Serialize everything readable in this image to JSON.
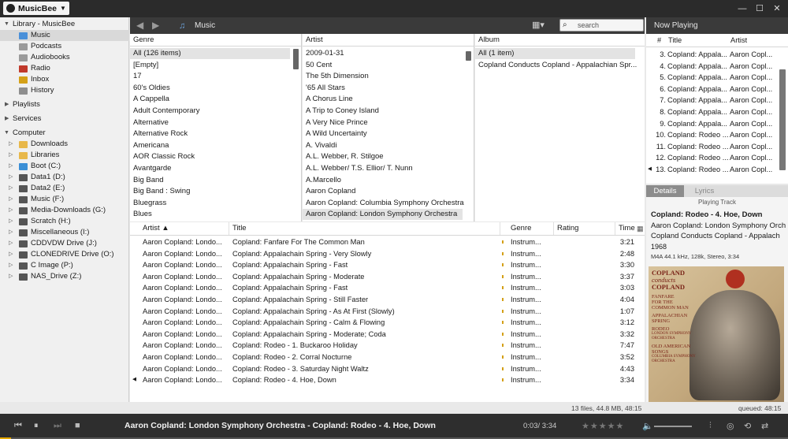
{
  "app": {
    "title": "MusicBee"
  },
  "sidebar": {
    "library_header": "Library - MusicBee",
    "library_items": [
      "Music",
      "Podcasts",
      "Audiobooks",
      "Radio",
      "Inbox",
      "History"
    ],
    "playlists": "Playlists",
    "services": "Services",
    "computer_header": "Computer",
    "drives": [
      "Downloads",
      "Libraries",
      "Boot (C:)",
      "Data1 (D:)",
      "Data2 (E:)",
      "Music (F:)",
      "Media-Downloads (G:)",
      "Scratch (H:)",
      "Miscellaneous (I:)",
      "CDDVDW Drive (J:)",
      "CLONEDRIVE Drive (O:)",
      "C Image (P:)",
      "NAS_Drive (Z:)"
    ]
  },
  "toolbar": {
    "title": "Music",
    "search_placeholder": "search"
  },
  "browser": {
    "genre": {
      "header": "Genre",
      "items": [
        "All  (126 items)",
        "[Empty]",
        "17",
        "60's Oldies",
        "A Cappella",
        "Adult Contemporary",
        "Alternative",
        "Alternative Rock",
        "Americana",
        "AOR Classic Rock",
        "Avantgarde",
        "Big Band",
        "Big Band : Swing",
        "Bluegrass",
        "Blues"
      ]
    },
    "artist": {
      "header": "Artist",
      "items": [
        "2009-01-31",
        "50 Cent",
        "The 5th Dimension",
        "'65 All Stars",
        "A Chorus Line",
        "A Trip to Coney Island",
        "A Very Nice Prince",
        "A Wild Uncertainty",
        "A. Vivaldi",
        "A.L. Webber, R. Stilgoe",
        "A.L. Webber/ T.S. Ellior/ T. Nunn",
        "A.Marcello",
        "Aaron Copland",
        "Aaron Copland: Columbia Symphony Orchestra",
        "Aaron Copland: London Symphony Orchestra"
      ]
    },
    "album": {
      "header": "Album",
      "items": [
        "All  (1 item)",
        "Copland Conducts Copland - Appalachian Spr..."
      ]
    }
  },
  "tracklist": {
    "columns": {
      "artist": "Artist",
      "title": "Title",
      "genre": "Genre",
      "rating": "Rating",
      "time": "Time"
    },
    "rows": [
      {
        "artist": "Aaron Copland: Londo...",
        "title": "Copland: Fanfare For The Common Man",
        "genre": "Instrum...",
        "time": "3:21"
      },
      {
        "artist": "Aaron Copland: Londo...",
        "title": "Copland: Appalachain Spring - Very Slowly",
        "genre": "Instrum...",
        "time": "2:48"
      },
      {
        "artist": "Aaron Copland: Londo...",
        "title": "Copland: Appalachain Spring - Fast",
        "genre": "Instrum...",
        "time": "3:30"
      },
      {
        "artist": "Aaron Copland: Londo...",
        "title": "Copland: Appalachain Spring - Moderate",
        "genre": "Instrum...",
        "time": "3:37"
      },
      {
        "artist": "Aaron Copland: Londo...",
        "title": "Copland: Appalachain Spring - Fast",
        "genre": "Instrum...",
        "time": "3:03"
      },
      {
        "artist": "Aaron Copland: Londo...",
        "title": "Copland: Appalachain Spring - Still Faster",
        "genre": "Instrum...",
        "time": "4:04"
      },
      {
        "artist": "Aaron Copland: Londo...",
        "title": "Copland: Appalachain Spring - As At First (Slowly)",
        "genre": "Instrum...",
        "time": "1:07"
      },
      {
        "artist": "Aaron Copland: Londo...",
        "title": "Copland: Appalachain Spring - Calm & Flowing",
        "genre": "Instrum...",
        "time": "3:12"
      },
      {
        "artist": "Aaron Copland: Londo...",
        "title": "Copland: Appalachain Spring - Moderate; Coda",
        "genre": "Instrum...",
        "time": "3:32"
      },
      {
        "artist": "Aaron Copland: Londo...",
        "title": "Copland: Rodeo - 1. Buckaroo Holiday",
        "genre": "Instrum...",
        "time": "7:47"
      },
      {
        "artist": "Aaron Copland: Londo...",
        "title": "Copland: Rodeo - 2. Corral Nocturne",
        "genre": "Instrum...",
        "time": "3:52"
      },
      {
        "artist": "Aaron Copland: Londo...",
        "title": "Copland: Rodeo - 3. Saturday Night Waltz",
        "genre": "Instrum...",
        "time": "4:43"
      },
      {
        "artist": "Aaron Copland: Londo...",
        "title": "Copland: Rodeo - 4. Hoe, Down",
        "genre": "Instrum...",
        "time": "3:34"
      }
    ],
    "playing_index": 12
  },
  "now_playing": {
    "header": "Now Playing",
    "columns": {
      "num": "#",
      "title": "Title",
      "artist": "Artist"
    },
    "rows": [
      {
        "num": "3.",
        "title": "Copland: Appala...",
        "artist": "Aaron Copl..."
      },
      {
        "num": "4.",
        "title": "Copland: Appala...",
        "artist": "Aaron Copl..."
      },
      {
        "num": "5.",
        "title": "Copland: Appala...",
        "artist": "Aaron Copl..."
      },
      {
        "num": "6.",
        "title": "Copland: Appala...",
        "artist": "Aaron Copl..."
      },
      {
        "num": "7.",
        "title": "Copland: Appala...",
        "artist": "Aaron Copl..."
      },
      {
        "num": "8.",
        "title": "Copland: Appala...",
        "artist": "Aaron Copl..."
      },
      {
        "num": "9.",
        "title": "Copland: Appala...",
        "artist": "Aaron Copl..."
      },
      {
        "num": "10.",
        "title": "Copland: Rodeo ...",
        "artist": "Aaron Copl..."
      },
      {
        "num": "11.",
        "title": "Copland: Rodeo ...",
        "artist": "Aaron Copl..."
      },
      {
        "num": "12.",
        "title": "Copland: Rodeo ...",
        "artist": "Aaron Copl..."
      },
      {
        "num": "13.",
        "title": "Copland: Rodeo ...",
        "artist": "Aaron Copl..."
      }
    ],
    "tabs": [
      "Details",
      "Lyrics"
    ]
  },
  "details": {
    "playing_track_label": "Playing Track",
    "title": "Copland: Rodeo - 4. Hoe, Down",
    "artist": "Aaron Copland: London Symphony Orch",
    "album": "Copland Conducts Copland - Appalach",
    "year": "1968",
    "format": "M4A 44.1 kHz, 128k, Stereo, 3:34",
    "art_text": {
      "line1": "COPLAND",
      "line2": "conducts",
      "line3": "COPLAND",
      "line4": "FANFARE",
      "line5": "FOR THE",
      "line6": "COMMON MAN",
      "line7": "APPALACHIAN",
      "line8": "SPRING",
      "line9": "RODEO",
      "line10": "LONDON SYMPHONY",
      "line11": "ORCHESTRA",
      "line12": "OLD AMERICAN",
      "line13": "SONGS",
      "line14": "COLUMBIA SYMPHONY",
      "line15": "ORCHESTRA"
    }
  },
  "status": {
    "summary": "13 files, 44.8 MB, 48:15",
    "queued": "queued: 48:15"
  },
  "player": {
    "now_playing": "Aaron Copland: London Symphony Orchestra - Copland: Rodeo - 4. Hoe, Down",
    "time": "0:03/ 3:34",
    "progress": 0.014
  },
  "colors": {
    "dark": "#2b2b2b",
    "accent": "#e6a800",
    "selection": "#d9d9d9"
  }
}
